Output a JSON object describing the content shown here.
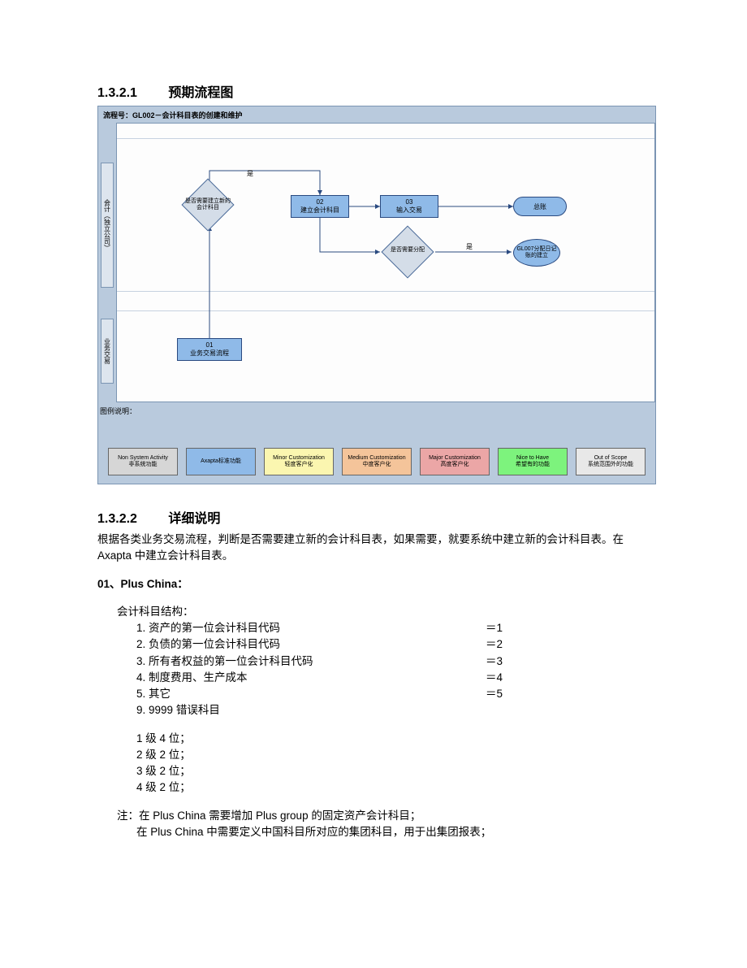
{
  "heading1": {
    "num": "1.3.2.1",
    "title": "预期流程图"
  },
  "heading2": {
    "num": "1.3.2.2",
    "title": "详细说明"
  },
  "flow": {
    "titlebar": "流程号：GL002－会计科目表的创建和维护",
    "lane1": "会计（独立公司）",
    "lane2": "业务交易",
    "decision1": "是否需要建立新的会计科目",
    "decision2": "是否需要分配",
    "proc01a": "01",
    "proc01b": "业务交易流程",
    "proc02a": "02",
    "proc02b": "建立会计科目",
    "proc03a": "03",
    "proc03b": "输入交易",
    "term": "总账",
    "sub": "GL007分配日记账的建立",
    "yes": "是"
  },
  "legend": {
    "label": "图例说明：",
    "items": [
      {
        "l1": "Non System Activity",
        "l2": "非系统功能"
      },
      {
        "l1": "Axapta标准功能",
        "l2": ""
      },
      {
        "l1": "Minor Customization",
        "l2": "轻度客户化"
      },
      {
        "l1": "Medium Customization",
        "l2": "中度客户化"
      },
      {
        "l1": "Major Customization",
        "l2": "高度客户化"
      },
      {
        "l1": "Nice to Have",
        "l2": "希望有的功能"
      },
      {
        "l1": "Out of Scope",
        "l2": "系统范围外的功能"
      }
    ]
  },
  "detail": {
    "intro": "根据各类业务交易流程，判断是否需要建立新的会计科目表，如果需要，就要系统中建立新的会计科目表。在 Axapta 中建立会计科目表。",
    "subhead": "01、Plus China：",
    "structLabel": "会计科目结构：",
    "rows": [
      {
        "n": "1.",
        "k": "资产的第一位会计科目代码",
        "v": "＝1"
      },
      {
        "n": "2.",
        "k": "负债的第一位会计科目代码",
        "v": "＝2"
      },
      {
        "n": "3.",
        "k": "所有者权益的第一位会计科目代码",
        "v": "＝3"
      },
      {
        "n": "4.",
        "k": "制度费用、生产成本",
        "v": "＝4"
      },
      {
        "n": "5.",
        "k": "其它",
        "v": "＝5"
      },
      {
        "n": "9.",
        "k": "9999 错误科目",
        "v": ""
      }
    ],
    "levels": [
      "1 级 4 位；",
      "2 级 2 位；",
      "3 级 2 位；",
      "4 级 2 位；"
    ],
    "note1": "注：在 Plus China 需要增加 Plus group 的固定资产会计科目；",
    "note2": "在 Plus China 中需要定义中国科目所对应的集团科目，用于出集团报表；"
  }
}
